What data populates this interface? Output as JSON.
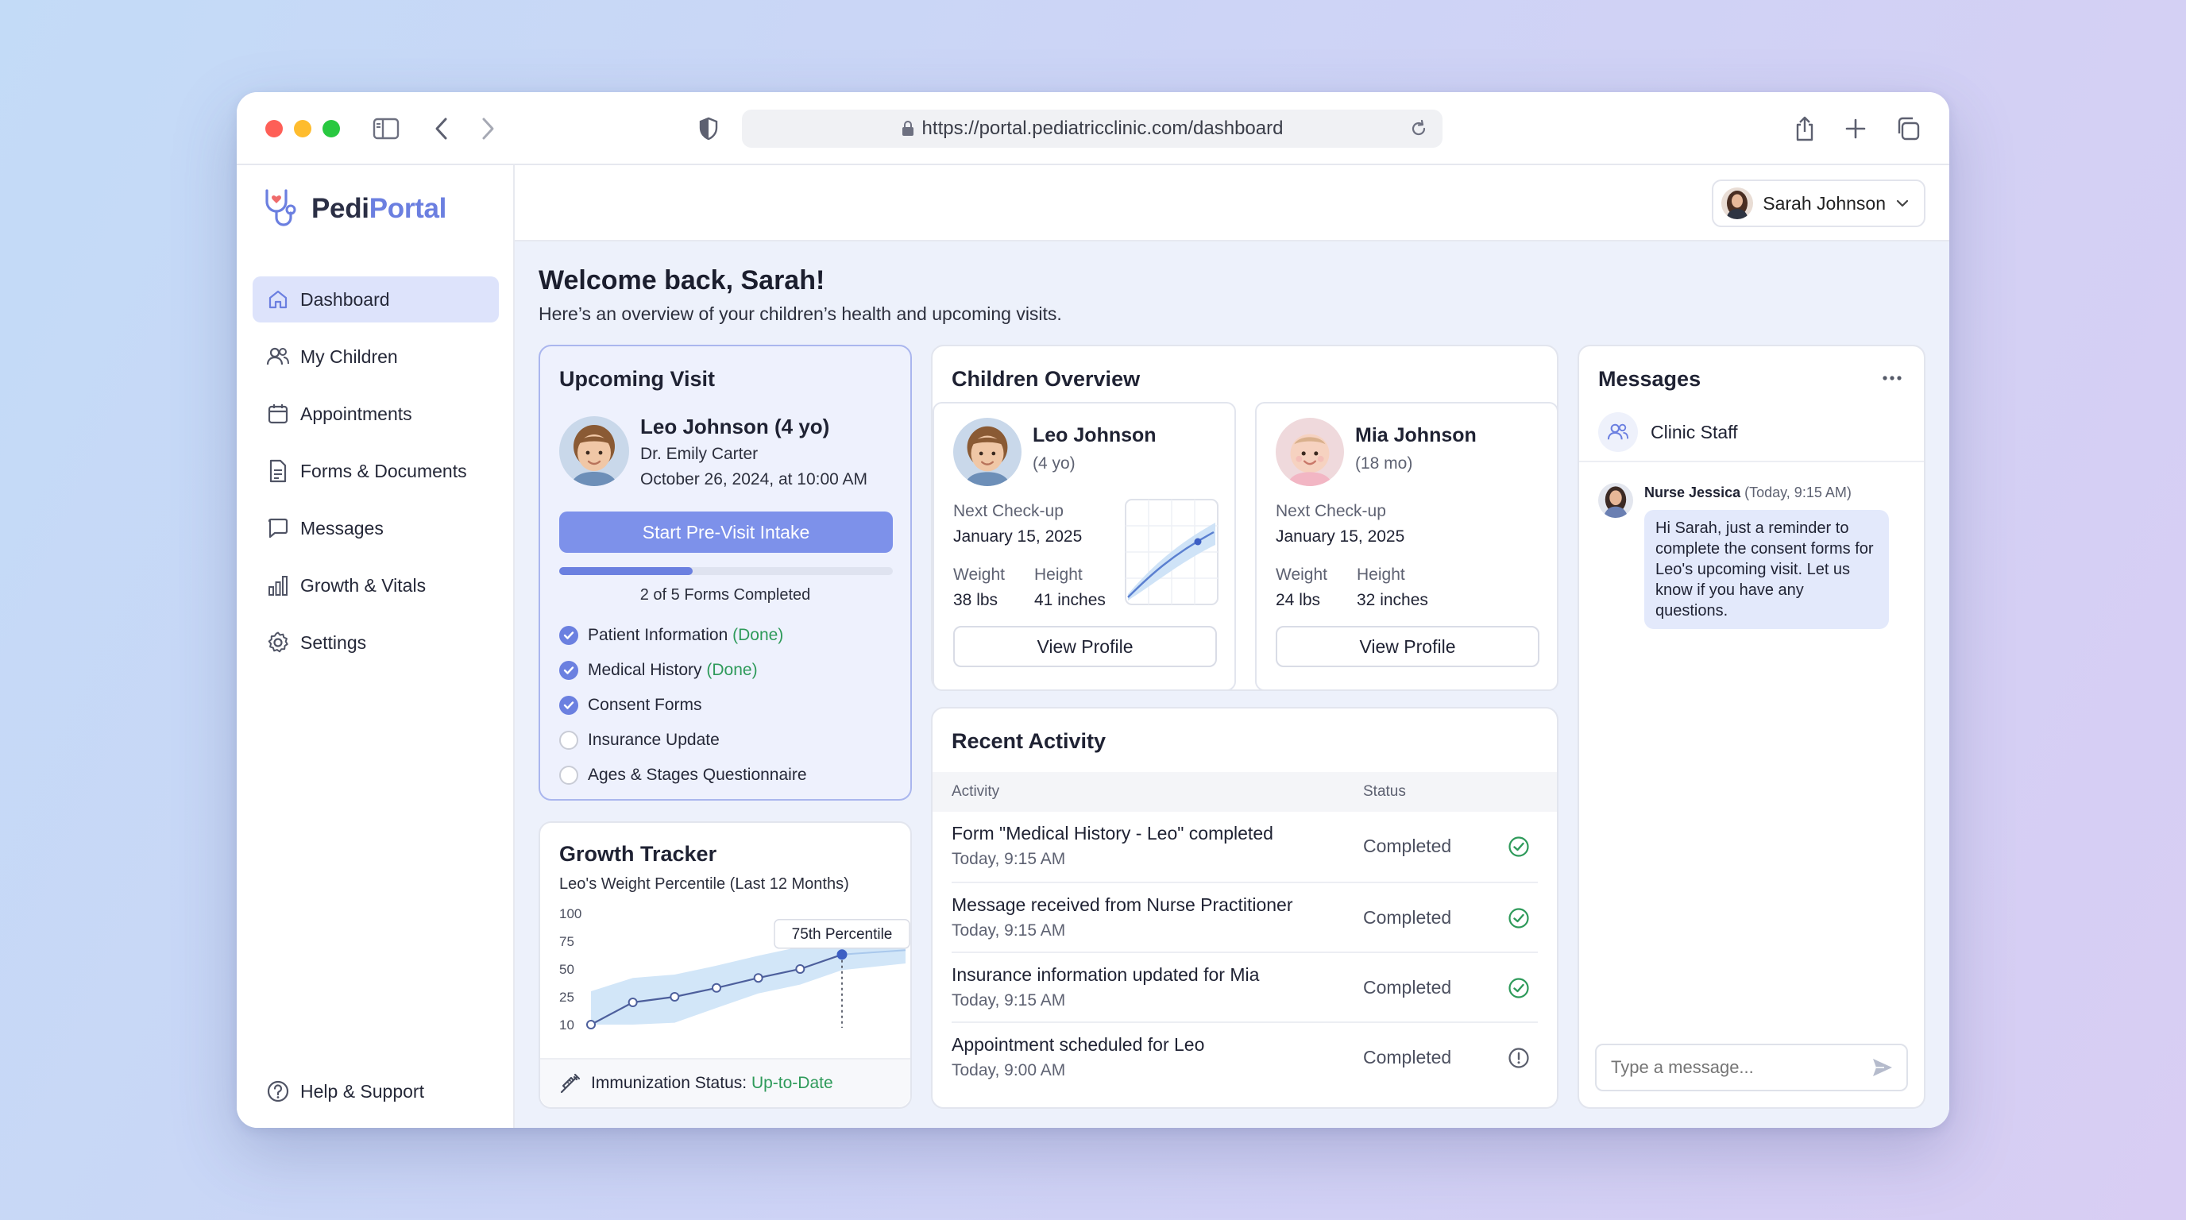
{
  "browser": {
    "url": "https://portal.pediatricclinic.com/dashboard"
  },
  "app": {
    "logo_first": "Pedi",
    "logo_second": "Portal",
    "accent_color": "#6b7fe0"
  },
  "nav": {
    "items": [
      {
        "label": "Dashboard",
        "icon": "home-icon",
        "active": true
      },
      {
        "label": "My Children",
        "icon": "users-icon"
      },
      {
        "label": "Appointments",
        "icon": "calendar-icon"
      },
      {
        "label": "Forms & Documents",
        "icon": "document-icon"
      },
      {
        "label": "Messages",
        "icon": "chat-icon"
      },
      {
        "label": "Growth & Vitals",
        "icon": "bar-chart-icon"
      },
      {
        "label": "Settings",
        "icon": "gear-icon"
      }
    ],
    "help": "Help & Support"
  },
  "user": {
    "name": "Sarah Johnson"
  },
  "welcome": {
    "title": "Welcome back, Sarah!",
    "subtitle": "Here’s an overview of your children’s health and upcoming visits."
  },
  "upcoming": {
    "title": "Upcoming Visit",
    "child": "Leo Johnson (4 yo)",
    "doctor": "Dr. Emily Carter",
    "datetime": "October 26, 2024, at 10:00 AM",
    "button": "Start Pre-Visit Intake",
    "progress": 0.4,
    "progress_label": "2 of 5 Forms Completed",
    "checklist": [
      {
        "label": "Patient Information",
        "suffix": "(Done)",
        "done": true
      },
      {
        "label": "Medical History",
        "suffix": "(Done)",
        "done": true
      },
      {
        "label": "Consent Forms",
        "suffix": "",
        "done": true
      },
      {
        "label": "Insurance Update",
        "suffix": "",
        "done": false
      },
      {
        "label": "Ages & Stages Questionnaire",
        "suffix": "",
        "done": false
      }
    ]
  },
  "growth": {
    "title": "Growth Tracker",
    "subtitle": "Leo's Weight Percentile (Last 12 Months)",
    "tooltip": "75th Percentile",
    "immunization_label": "Immunization Status:",
    "immunization_value": "Up-to-Date"
  },
  "chart_data": {
    "type": "line",
    "yticks": [
      100,
      75,
      50,
      25,
      10
    ],
    "ylim": [
      0,
      100
    ],
    "series": [
      {
        "values": [
          10,
          22,
          25,
          33,
          42,
          50,
          63
        ]
      }
    ]
  },
  "children": {
    "title": "Children Overview",
    "kids": [
      {
        "name": "Leo Johnson",
        "age": "(4 yo)",
        "next_label": "Next Check-up",
        "next_date": "January 15, 2025",
        "weight_label": "Weight",
        "weight": "38 lbs",
        "height_label": "Height",
        "height": "41 inches",
        "button": "View Profile"
      },
      {
        "name": "Mia Johnson",
        "age": "(18 mo)",
        "next_label": "Next Check-up",
        "next_date": "January 15, 2025",
        "weight_label": "Weight",
        "weight": "24 lbs",
        "height_label": "Height",
        "height": "32 inches",
        "button": "View Profile"
      }
    ]
  },
  "activity": {
    "title": "Recent Activity",
    "col_activity": "Activity",
    "col_status": "Status",
    "rows": [
      {
        "title": "Form \"Medical History - Leo\" completed",
        "time": "Today, 9:15 AM",
        "status": "Completed",
        "icon": "check-circle-icon"
      },
      {
        "title": "Message received from Nurse Practitioner",
        "time": "Today, 9:15 AM",
        "status": "Completed",
        "icon": "check-circle-icon"
      },
      {
        "title": "Insurance information updated for Mia",
        "time": "Today, 9:15 AM",
        "status": "Completed",
        "icon": "check-circle-icon"
      },
      {
        "title": "Appointment scheduled for Leo",
        "time": "Today, 9:00 AM",
        "status": "Completed",
        "icon": "info-circle-icon"
      }
    ]
  },
  "messages": {
    "title": "Messages",
    "channel": "Clinic Staff",
    "sender": "Nurse Jessica",
    "sent_at": "(Today, 9:15 AM)",
    "body": "Hi Sarah, just a reminder to complete the consent forms for Leo's upcoming visit. Let us know if you have any questions.",
    "placeholder": "Type a message..."
  }
}
